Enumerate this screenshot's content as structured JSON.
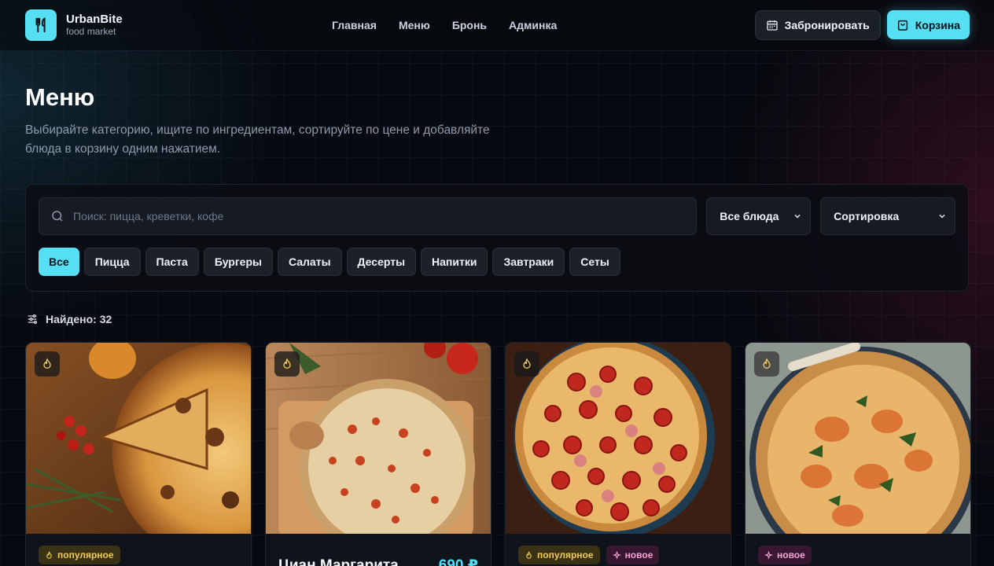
{
  "brand": {
    "name": "UrbanBite",
    "subtitle": "food market"
  },
  "nav": [
    {
      "label": "Главная"
    },
    {
      "label": "Меню"
    },
    {
      "label": "Бронь"
    },
    {
      "label": "Админка"
    }
  ],
  "header_actions": {
    "book_label": "Забронировать",
    "cart_label": "Корзина"
  },
  "hero": {
    "title": "Меню",
    "description": "Выбирайте категорию, ищите по ингредиентам, сортируйте по цене и добавляйте блюда в корзину одним нажатием."
  },
  "filters": {
    "search_placeholder": "Поиск: пицца, креветки, кофе",
    "type_select": "Все блюда",
    "sort_select": "Сортировка",
    "categories": [
      {
        "label": "Все",
        "active": true
      },
      {
        "label": "Пицца"
      },
      {
        "label": "Паста"
      },
      {
        "label": "Бургеры"
      },
      {
        "label": "Салаты"
      },
      {
        "label": "Десерты"
      },
      {
        "label": "Напитки"
      },
      {
        "label": "Завтраки"
      },
      {
        "label": "Сеты"
      }
    ]
  },
  "results": {
    "found_label": "Найдено: 32"
  },
  "cards": [
    {
      "badges": [
        "популярное"
      ],
      "title": "",
      "price": ""
    },
    {
      "badges": [],
      "title": "Циан Маргарита",
      "price": "690 ₽"
    },
    {
      "badges": [
        "популярное",
        "новое"
      ],
      "title": "",
      "price": ""
    },
    {
      "badges": [
        "новое"
      ],
      "title": "",
      "price": ""
    }
  ],
  "badge_labels": {
    "popular": "популярное",
    "new": "новое"
  },
  "colors": {
    "accent": "#56dff2",
    "popular": "#f1cc5b",
    "new": "#f2a8d6",
    "background": "#070a10"
  },
  "icons": [
    "utensils-icon",
    "calendar-icon",
    "shopping-bag-icon",
    "search-icon",
    "chevron-down-icon",
    "sliders-icon",
    "flame-icon",
    "sparkles-icon"
  ]
}
